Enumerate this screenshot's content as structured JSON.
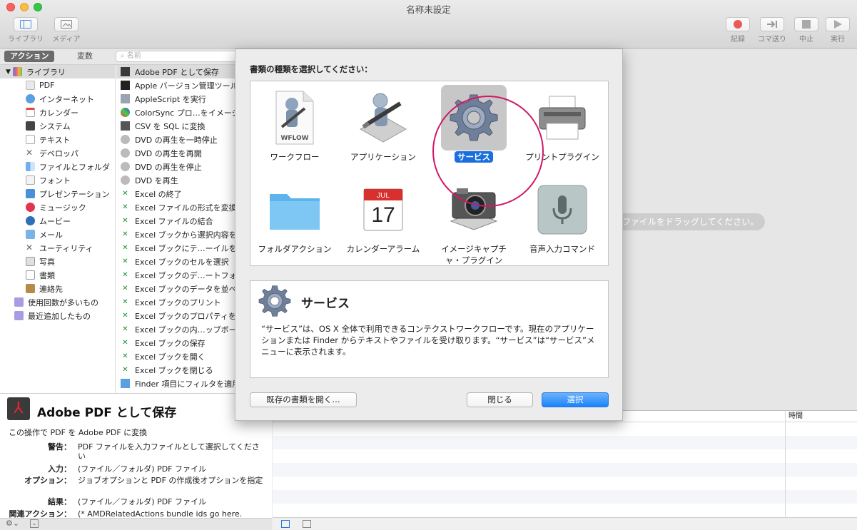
{
  "window": {
    "title": "名称未設定"
  },
  "toolbar": {
    "left": [
      {
        "label": "ライブラリ",
        "icon": "library-icon"
      },
      {
        "label": "メディア",
        "icon": "media-icon"
      }
    ],
    "right": [
      {
        "label": "記録",
        "icon": "record-icon"
      },
      {
        "label": "コマ送り",
        "icon": "step-icon"
      },
      {
        "label": "中止",
        "icon": "stop-icon"
      },
      {
        "label": "実行",
        "icon": "run-icon"
      }
    ]
  },
  "segment": {
    "actions": "アクション",
    "variables": "変数"
  },
  "search": {
    "placeholder": "名前"
  },
  "library": {
    "header": "ライブラリ",
    "items": [
      "PDF",
      "インターネット",
      "カレンダー",
      "システム",
      "テキスト",
      "デベロッパ",
      "ファイルとフォルダ",
      "フォント",
      "プレゼンテーション",
      "ミュージック",
      "ムービー",
      "メール",
      "ユーティリティ",
      "写真",
      "書類",
      "連絡先"
    ],
    "smart": [
      "使用回数が多いもの",
      "最近追加したもの"
    ]
  },
  "actions": [
    "Adobe PDF として保存",
    "Apple バージョン管理ツール",
    "AppleScript を実行",
    "ColorSync プロ…をイメージ",
    "CSV を SQL に変換",
    "DVD の再生を一時停止",
    "DVD の再生を再開",
    "DVD の再生を停止",
    "DVD を再生",
    "Excel の終了",
    "Excel ファイルの形式を変換",
    "Excel ファイルの結合",
    "Excel ブックから選択内容を",
    "Excel ブックにテ…ーイルをイ",
    "Excel ブックのセルを選択",
    "Excel ブックのデ…ートフォ",
    "Excel ブックのデータを並べ",
    "Excel ブックのプリント",
    "Excel ブックのプロパティを",
    "Excel ブックの内…ッブボー",
    "Excel ブックの保存",
    "Excel ブックを開く",
    "Excel ブックを閉じる",
    "Finder 項目にフィルタを適用"
  ],
  "description": {
    "title": "Adobe PDF として保存",
    "subtitle": "この操作で PDF を Adobe PDF に変換",
    "fields": [
      {
        "key": "警告：",
        "value": "PDF ファイルを入力ファイルとして選択してください"
      },
      {
        "key": "入力：",
        "value": "(ファイル／フォルダ) PDF ファイル"
      },
      {
        "key": "オプション：",
        "value": "ジョブオプションと PDF の作成後オプションを指定"
      },
      {
        "key": "結果：",
        "value": "(ファイル／フォルダ) PDF ファイル"
      },
      {
        "key": "関連アクション：",
        "value": "(* AMDRelatedActions bundle ids go here."
      }
    ]
  },
  "workflow": {
    "drag_hint": "ファイルをドラッグしてください。"
  },
  "log": {
    "time_header": "時間"
  },
  "dialog": {
    "prompt": "書類の種類を選択してください：",
    "types": [
      {
        "label": "ワークフロー",
        "icon": "workflow-icon",
        "selected": false
      },
      {
        "label": "アプリケーション",
        "icon": "application-icon",
        "selected": false
      },
      {
        "label": "サービス",
        "icon": "gear-icon",
        "selected": true
      },
      {
        "label": "プリントプラグイン",
        "icon": "printer-icon",
        "selected": false
      },
      {
        "label": "フォルダアクション",
        "icon": "folder-icon",
        "selected": false
      },
      {
        "label": "カレンダーアラーム",
        "icon": "calendar-icon",
        "selected": false
      },
      {
        "label": "イメージキャプチャ・プラグイン",
        "icon": "camera-icon",
        "selected": false
      },
      {
        "label": "音声入力コマンド",
        "icon": "microphone-icon",
        "selected": false
      }
    ],
    "workflow_badge": "WFLOW",
    "calendar_month": "JUL",
    "calendar_day": "17",
    "detail_title": "サービス",
    "detail_text": "“サービス”は、OS X 全体で利用できるコンテクストワークフローです。現在のアプリケーションまたは Finder からテキストやファイルを受け取ります。“サービス”は“サービス”メニューに表示されます。",
    "open_existing": "既存の書類を開く…",
    "close": "閉じる",
    "choose": "選択"
  },
  "colors": {
    "accent": "#1a6fdf",
    "highlight_ring": "#d01867"
  }
}
